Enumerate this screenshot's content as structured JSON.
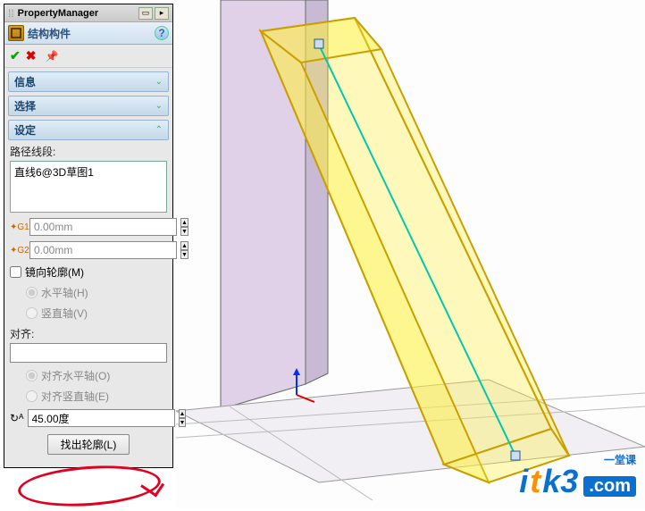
{
  "header": {
    "title": "PropertyManager"
  },
  "feature": {
    "name": "结构构件",
    "help": "?"
  },
  "sections": {
    "info": {
      "title": "信息"
    },
    "select": {
      "title": "选择"
    },
    "settings": {
      "title": "设定",
      "path_seg_label": "路径线段:",
      "path_items": [
        "直线6@3D草图1"
      ],
      "g1_value": "0.00mm",
      "g2_value": "0.00mm",
      "mirror_label": "镜向轮廓(M)",
      "mirror_checked": false,
      "horiz_axis_label": "水平轴(H)",
      "vert_axis_label": "竖直轴(V)",
      "align_label": "对齐:",
      "align_horiz_label": "对齐水平轴(O)",
      "align_vert_label": "对齐竖直轴(E)",
      "angle_value": "45.00度",
      "find_profile_label": "找出轮廓(L)"
    }
  },
  "watermark": {
    "text": "itk3",
    "suffix": ".com",
    "tagline": "一堂课"
  }
}
